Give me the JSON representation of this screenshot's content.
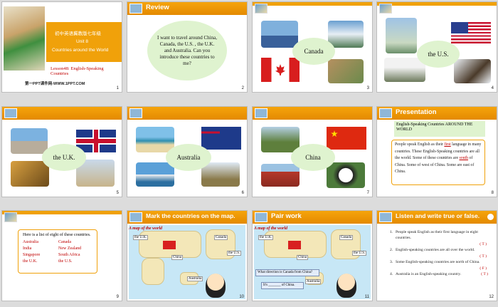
{
  "slides": [
    {
      "num": "1",
      "course": "初中英语冀教版七年级",
      "unit": "Unit 8",
      "unit_title": "Countries around the World",
      "lesson": "Lesson48: English-Speaking Countries",
      "website": "第一PPT课件网-WWW.1PPT.COM"
    },
    {
      "num": "2",
      "title": "Review",
      "bubble": "I want to travel around China, Canada, the U.S. , the U.K. and Australia. Can you introduce these countries to me?"
    },
    {
      "num": "3",
      "label": "Canada"
    },
    {
      "num": "4",
      "label": "the U.S."
    },
    {
      "num": "5",
      "label": "the U.K."
    },
    {
      "num": "6",
      "label": "Australia"
    },
    {
      "num": "7",
      "label": "China"
    },
    {
      "num": "8",
      "title": "Presentation",
      "header": "English-Speaking Countries AROUND THE WORLD",
      "para_1": "People speak English as their ",
      "blank_1": "first",
      "para_2": " language in many countries. These English-Speaking countries are all the world. Some of these countries are ",
      "blank_2": "south",
      "para_3": " of China. Some of west of China. Some are east of China."
    },
    {
      "num": "9",
      "intro": "Here is a list of eight of these countries.",
      "countries": [
        [
          "Australia",
          "Canada"
        ],
        [
          "India",
          "New Zealand"
        ],
        [
          "Singapore",
          "South Africa"
        ],
        [
          "the U.K.",
          "the U.S."
        ]
      ]
    },
    {
      "num": "10",
      "title": "Mark the countries on the map.",
      "map_title": "A map of the world",
      "labels": [
        "the U.K.",
        "Canada",
        "China",
        "the U.S.",
        "Australia"
      ]
    },
    {
      "num": "11",
      "title": "Pair work",
      "map_title": "A map of the world",
      "labels": [
        "the U.K.",
        "Canada",
        "China",
        "the U.S.",
        "Australia"
      ],
      "question": "What direction is Canada from China?",
      "answer": "It's _______ of China."
    },
    {
      "num": "12",
      "title": "Listen and write true or false.",
      "items": [
        {
          "n": "1.",
          "text": "People speak English as their first language in eight countries.",
          "ans": "( T )"
        },
        {
          "n": "2.",
          "text": "English-speaking countries are all over the world.",
          "ans": "( T )"
        },
        {
          "n": "3.",
          "text": "Some English-speaking countries are north of China.",
          "ans": "( F )"
        },
        {
          "n": "4.",
          "text": "Australia is an English-speaking country.",
          "ans": "( T )"
        }
      ]
    }
  ],
  "colors": {
    "orange": "#f0a10a",
    "red": "#c00000",
    "bubble": "#dff3cf"
  }
}
